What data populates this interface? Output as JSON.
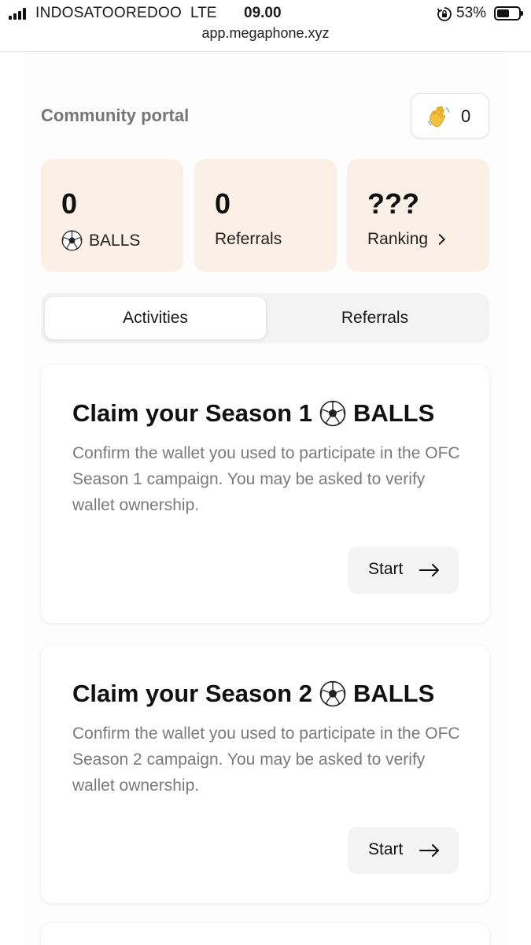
{
  "status_bar": {
    "carrier": "INDOSATOOREDOO",
    "network": "LTE",
    "time": "09.00",
    "battery": "53%",
    "battery_level": 0.53
  },
  "browser": {
    "url": "app.megaphone.xyz"
  },
  "header": {
    "title": "Community portal",
    "wave_icon": "waving-hand-icon",
    "wave_count": "0"
  },
  "stats": [
    {
      "value": "0",
      "label": "BALLS",
      "icon": "soccer-ball-icon"
    },
    {
      "value": "0",
      "label": "Referrals"
    },
    {
      "value": "???",
      "label": "Ranking",
      "icon": "chevron-right-icon"
    }
  ],
  "tabs": [
    {
      "label": "Activities",
      "active": true
    },
    {
      "label": "Referrals",
      "active": false
    }
  ],
  "activities": [
    {
      "title_prefix": "Claim your Season 1",
      "title_suffix": "BALLS",
      "description": "Confirm the wallet you used to participate in the OFC Season 1 campaign. You may be asked to verify wallet ownership.",
      "button_label": "Start"
    },
    {
      "title_prefix": "Claim your Season 2",
      "title_suffix": "BALLS",
      "description": "Confirm the wallet you used to participate in the OFC Season 2 campaign. You may be asked to verify wallet ownership.",
      "button_label": "Start"
    }
  ],
  "colors": {
    "stat_card_bg": "#faf0e5",
    "muted_text": "#7a7a7a",
    "tab_track": "#f3f3f3",
    "button_bg": "#f4f4f4"
  }
}
